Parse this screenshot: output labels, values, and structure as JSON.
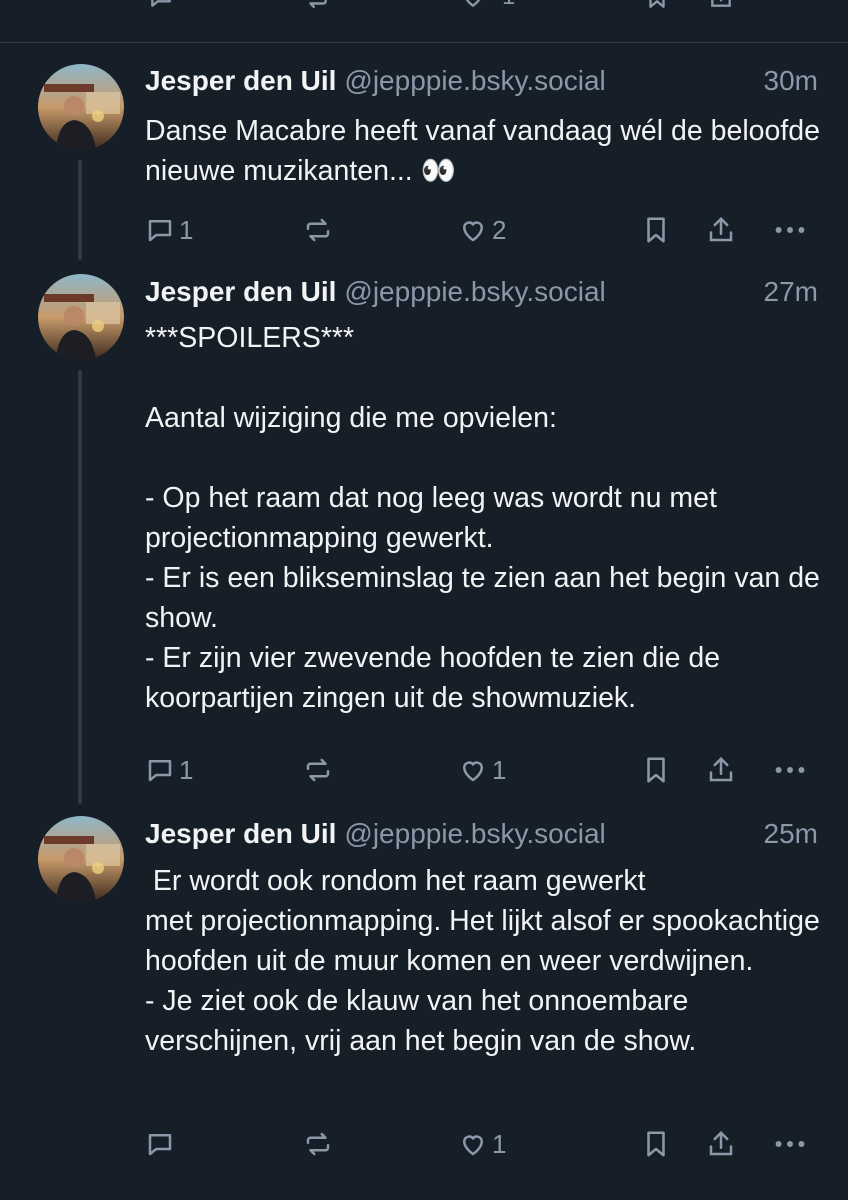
{
  "previous_post_actions": {
    "like_count": "1"
  },
  "posts": [
    {
      "author": "Jesper den Uil",
      "handle": "@jepppie.bsky.social",
      "time": "30m",
      "text": "Danse Macabre heeft vanaf vandaag wél de beloofde nieuwe muzikanten... 👀",
      "reply_count": "1",
      "repost_count": "",
      "like_count": "2"
    },
    {
      "author": "Jesper den Uil",
      "handle": "@jepppie.bsky.social",
      "time": "27m",
      "text": "***SPOILERS***\n\nAantal wijziging die me opvielen:\n\n- Op het raam dat nog leeg was wordt nu met projectionmapping gewerkt.\n- Er is een blikseminslag te zien aan het begin van de show.\n- Er zijn vier zwevende hoofden te zien die de koorpartijen zingen uit de showmuziek.",
      "reply_count": "1",
      "repost_count": "",
      "like_count": "1"
    },
    {
      "author": "Jesper den Uil",
      "handle": "@jepppie.bsky.social",
      "time": "25m",
      "text": " Er wordt ook rondom het raam gewerkt\nmet projectionmapping. Het lijkt alsof er spookachtige hoofden uit de muur komen en weer verdwijnen.\n- Je ziet ook de klauw van het onnoembare verschijnen, vrij aan het begin van de show.",
      "reply_count": "",
      "repost_count": "",
      "like_count": "1"
    }
  ],
  "icons": {
    "reply": "reply-icon",
    "repost": "repost-icon",
    "like": "heart-icon",
    "bookmark": "bookmark-icon",
    "share": "share-icon",
    "more": "more-icon"
  },
  "colors": {
    "background": "#161e27",
    "text": "#f1f3f5",
    "muted": "#8b98a9",
    "divider": "#2e3a48"
  }
}
